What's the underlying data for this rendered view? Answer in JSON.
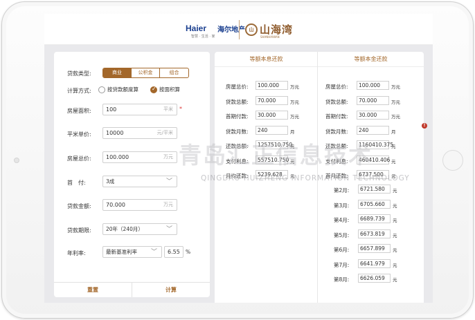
{
  "header": {
    "brand_left": "Haier",
    "brand_left_sub": "海尔地产",
    "brand_left_tag": "智慧 · 生活 · 家",
    "brand_right_mark": "山",
    "brand_right": "山海湾",
    "brand_right_sub": "SHANHAIWAN"
  },
  "form": {
    "loan_type_label": "贷款类型:",
    "loan_type_options": [
      "商业",
      "公积金",
      "组合"
    ],
    "loan_type_selected": "商业",
    "calc_method_label": "计算方式:",
    "calc_method_options": [
      "按贷款额度算",
      "按面积算"
    ],
    "calc_method_selected": "按面积算",
    "area_label": "房屋面积:",
    "area_value": "100",
    "area_unit": "平米",
    "unit_price_label": "平米单价:",
    "unit_price_value": "10000",
    "unit_price_unit": "元/平米",
    "total_price_label": "房屋总价:",
    "total_price_value": "100.000",
    "total_price_unit": "万元",
    "down_payment_label": "首　付:",
    "down_payment_value": "3成",
    "loan_amount_label": "贷款金额:",
    "loan_amount_value": "70.000",
    "loan_amount_unit": "万元",
    "loan_term_label": "贷款期限:",
    "loan_term_value": "20年（240月）",
    "rate_label": "年利率:",
    "rate_type_value": "最新基准利率",
    "rate_value": "6.55",
    "rate_unit": "%",
    "reset_button": "重置",
    "calc_button": "计算"
  },
  "results": {
    "equal_payment": {
      "title": "等额本息还款",
      "rows": [
        {
          "label": "房屋总价:",
          "value": "100.000",
          "unit": "万元"
        },
        {
          "label": "贷款总额:",
          "value": "70.000",
          "unit": "万元"
        },
        {
          "label": "首期付款:",
          "value": "30.000",
          "unit": "万元"
        },
        {
          "label": "贷款月数:",
          "value": "240",
          "unit": "月"
        },
        {
          "label": "还款总额:",
          "value": "1257510.750",
          "unit": "元"
        },
        {
          "label": "支付利息:",
          "value": "557510.750",
          "unit": "元"
        },
        {
          "label": "月均还款:",
          "value": "5239.628",
          "unit": "元"
        }
      ]
    },
    "equal_principal": {
      "title": "等额本金还款",
      "rows": [
        {
          "label": "房屋总价:",
          "value": "100.000",
          "unit": "万元"
        },
        {
          "label": "贷款总额:",
          "value": "70.000",
          "unit": "万元"
        },
        {
          "label": "首期付款:",
          "value": "30.000",
          "unit": "万元"
        },
        {
          "label": "贷款月数:",
          "value": "240",
          "unit": "月"
        },
        {
          "label": "还款总额:",
          "value": "1160410.375",
          "unit": "元"
        },
        {
          "label": "支付利息:",
          "value": "460410.406",
          "unit": "元"
        },
        {
          "label": "首月还款:",
          "value": "6737.500",
          "unit": "元"
        }
      ],
      "monthly": [
        {
          "label": "第2月:",
          "value": "6721.580",
          "unit": "元"
        },
        {
          "label": "第3月:",
          "value": "6705.660",
          "unit": "元"
        },
        {
          "label": "第4月:",
          "value": "6689.739",
          "unit": "元"
        },
        {
          "label": "第5月:",
          "value": "6673.819",
          "unit": "元"
        },
        {
          "label": "第6月:",
          "value": "6657.899",
          "unit": "元"
        },
        {
          "label": "第7月:",
          "value": "6641.979",
          "unit": "元"
        },
        {
          "label": "第8月:",
          "value": "6626.059",
          "unit": "元"
        }
      ]
    }
  },
  "watermark": {
    "cn": "青岛汇正信息技术",
    "en": "QINGDAO HUIZHENG INFORMATION TECHNOLOGY"
  },
  "alert_badge": "!"
}
